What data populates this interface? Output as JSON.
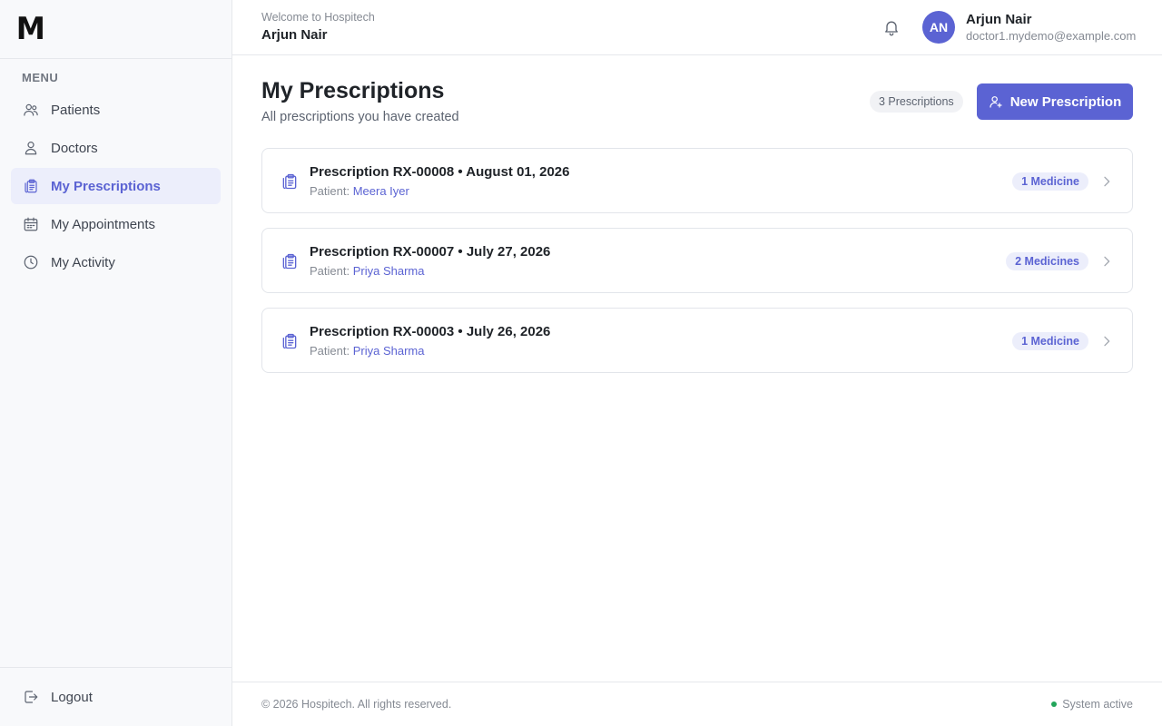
{
  "brand": {
    "logo_text": "M"
  },
  "sidebar": {
    "menu_label": "MENU",
    "items": [
      {
        "label": "Patients",
        "icon": "users-icon"
      },
      {
        "label": "Doctors",
        "icon": "user-icon"
      },
      {
        "label": "My Prescriptions",
        "icon": "clipboard-icon",
        "active": true
      },
      {
        "label": "My Appointments",
        "icon": "calendar-icon"
      },
      {
        "label": "My Activity",
        "icon": "clock-icon"
      }
    ],
    "logout_label": "Logout"
  },
  "header": {
    "welcome": "Welcome to Hospitech",
    "name": "Arjun Nair",
    "avatar_initials": "AN",
    "user_name": "Arjun Nair",
    "user_email": "doctor1.mydemo@example.com"
  },
  "main": {
    "title": "My Prescriptions",
    "subtitle": "All prescriptions you have created",
    "count_badge": "3 Prescriptions",
    "new_button": "New Prescription",
    "prescriptions": [
      {
        "title": "Prescription RX-00008 • August 01, 2026",
        "patient_label": "Patient:",
        "patient_name": "Meera Iyer",
        "medicines": "1 Medicine"
      },
      {
        "title": "Prescription RX-00007 • July 27, 2026",
        "patient_label": "Patient:",
        "patient_name": "Priya Sharma",
        "medicines": "2 Medicines"
      },
      {
        "title": "Prescription RX-00003 • July 26, 2026",
        "patient_label": "Patient:",
        "patient_name": "Priya Sharma",
        "medicines": "1 Medicine"
      }
    ]
  },
  "footer": {
    "copyright": "© 2026 Hospitech. All rights reserved.",
    "status": "System active"
  },
  "colors": {
    "accent": "#5b63d3",
    "status_green": "#22a55a"
  }
}
